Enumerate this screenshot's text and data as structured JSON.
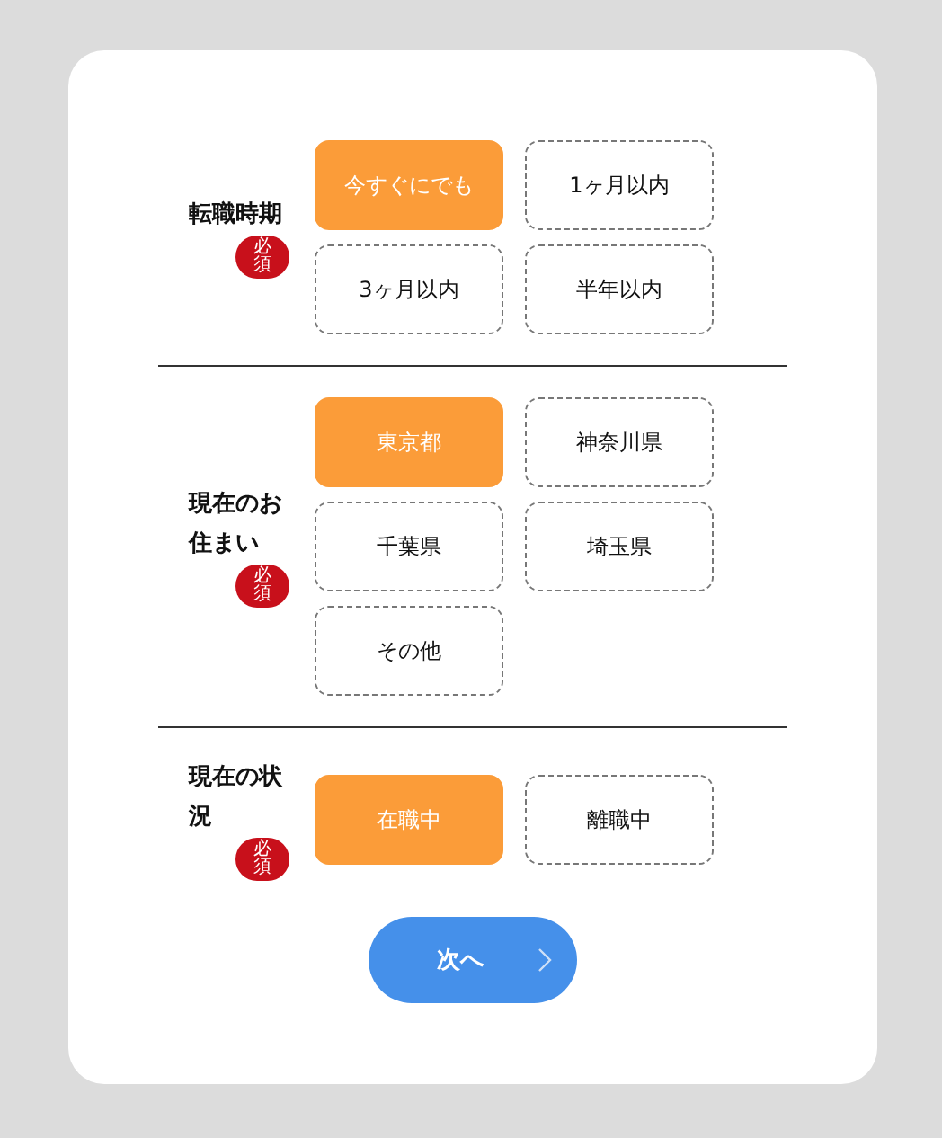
{
  "sections": [
    {
      "label": "転職時期",
      "required_badge": "必須",
      "options": [
        {
          "label": "今すぐにでも",
          "selected": true
        },
        {
          "label": "1ヶ月以内",
          "selected": false
        },
        {
          "label": "3ヶ月以内",
          "selected": false
        },
        {
          "label": "半年以内",
          "selected": false
        }
      ]
    },
    {
      "label": "現在のお住まい",
      "required_badge": "必須",
      "options": [
        {
          "label": "東京都",
          "selected": true
        },
        {
          "label": "神奈川県",
          "selected": false
        },
        {
          "label": "千葉県",
          "selected": false
        },
        {
          "label": "埼玉県",
          "selected": false
        },
        {
          "label": "その他",
          "selected": false
        }
      ]
    },
    {
      "label": "現在の状況",
      "required_badge": "必須",
      "options": [
        {
          "label": "在職中",
          "selected": true
        },
        {
          "label": "離職中",
          "selected": false
        }
      ]
    }
  ],
  "next_button": {
    "label": "次へ"
  }
}
